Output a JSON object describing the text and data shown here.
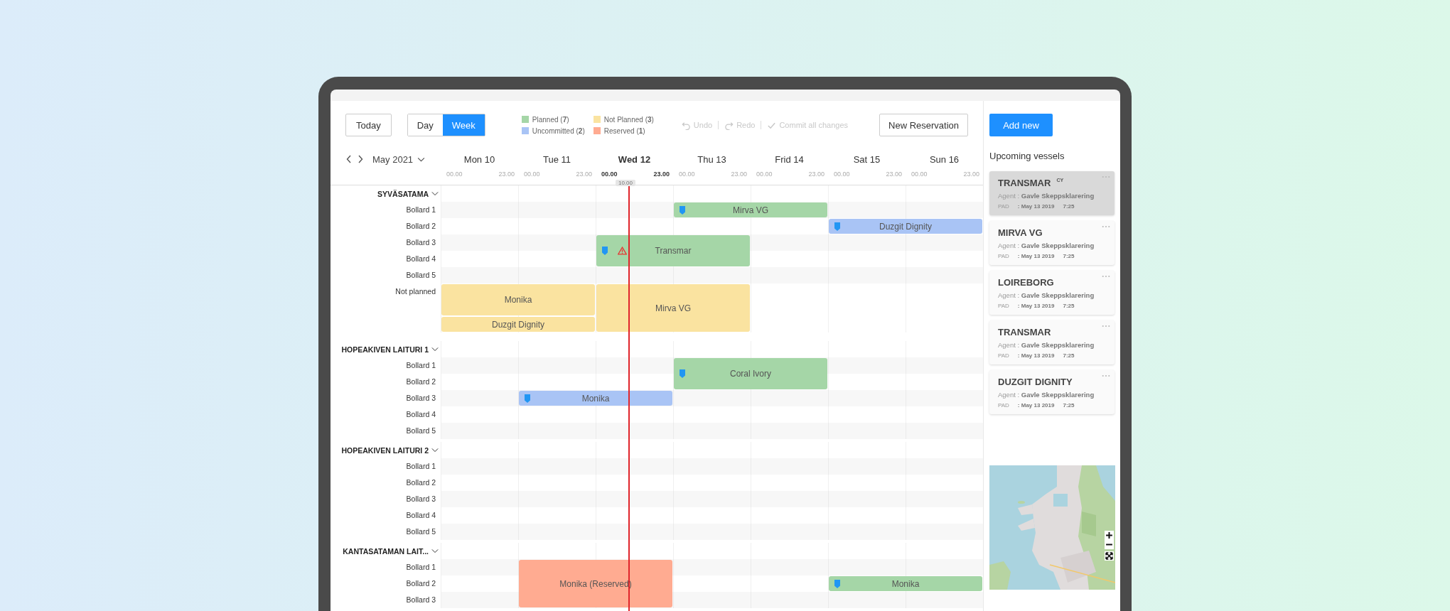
{
  "toolbar": {
    "today": "Today",
    "views": [
      {
        "label": "Day",
        "selected": false
      },
      {
        "label": "Week",
        "selected": true
      }
    ],
    "legend": [
      {
        "label": "Planned (**7**)",
        "color": "#a5d6a7"
      },
      {
        "label": "Not Planned (**3**)",
        "color": "#fae3a0"
      },
      {
        "label": "Uncommitted (**2**)",
        "color": "#a9c4f5"
      },
      {
        "label": "Reserved (**1**)",
        "color": "#ffab91"
      }
    ],
    "history": [
      {
        "kind": "undo",
        "label": "Undo",
        "disabled": true
      },
      {
        "kind": "redo",
        "label": "Redo",
        "disabled": true
      },
      {
        "kind": "commit",
        "label": "Commit all changes",
        "disabled": true
      }
    ],
    "new_reservation": "New Reservation"
  },
  "calendar": {
    "month": "May 2021",
    "now_marker": "10.00",
    "days": [
      {
        "label": "Mon 10",
        "start": "00.00",
        "end": "23.00",
        "selected": false
      },
      {
        "label": "Tue 11",
        "start": "00.00",
        "end": "23.00",
        "selected": false
      },
      {
        "label": "Wed 12",
        "start": "00.00",
        "end": "23.00",
        "selected": true
      },
      {
        "label": "Thu 13",
        "start": "00.00",
        "end": "23.00",
        "selected": false
      },
      {
        "label": "Frid 14",
        "start": "00.00",
        "end": "23.00",
        "selected": false
      },
      {
        "label": "Sat 15",
        "start": "00.00",
        "end": "23.00",
        "selected": false
      },
      {
        "label": "Sun 16",
        "start": "00.00",
        "end": "23.00",
        "selected": false
      }
    ],
    "groups": [
      {
        "name": "SYVÄSATAMA",
        "expanded": true,
        "lanes": [
          {
            "label": "Bollard 1",
            "kind": "bollard"
          },
          {
            "label": "Bollard 2",
            "kind": "bollard"
          },
          {
            "label": "Bollard 3",
            "kind": "bollard"
          },
          {
            "label": "Bollard 4",
            "kind": "bollard"
          },
          {
            "label": "Bollard 5",
            "kind": "bollard"
          },
          {
            "label": "Not planned",
            "kind": "unplanned"
          }
        ],
        "events": [
          {
            "label": "Mirva VG",
            "kind": "planned",
            "marker": true,
            "warning": false
          },
          {
            "label": "Duzgit Dignity",
            "kind": "uncommitted",
            "marker": true,
            "warning": false
          },
          {
            "label": "Transmar",
            "kind": "planned",
            "marker": true,
            "warning": true
          },
          {
            "label": "Monika",
            "kind": "not_planned",
            "marker": false,
            "warning": false
          },
          {
            "label": "Duzgit Dignity",
            "kind": "not_planned",
            "marker": false,
            "warning": false
          },
          {
            "label": "Mirva VG",
            "kind": "not_planned",
            "marker": false,
            "warning": false
          }
        ]
      },
      {
        "name": "HOPEAKIVEN LAITURI 1",
        "expanded": true,
        "lanes": [
          {
            "label": "Bollard 1",
            "kind": "bollard"
          },
          {
            "label": "Bollard 2",
            "kind": "bollard"
          },
          {
            "label": "Bollard 3",
            "kind": "bollard"
          },
          {
            "label": "Bollard 4",
            "kind": "bollard"
          },
          {
            "label": "Bollard 5",
            "kind": "bollard"
          }
        ],
        "events": [
          {
            "label": "Coral Ivory",
            "kind": "planned",
            "marker": true,
            "warning": false
          },
          {
            "label": "Monika",
            "kind": "uncommitted",
            "marker": true,
            "warning": false
          }
        ]
      },
      {
        "name": "HOPEAKIVEN LAITURI 2",
        "expanded": true,
        "lanes": [
          {
            "label": "Bollard 1",
            "kind": "bollard"
          },
          {
            "label": "Bollard 2",
            "kind": "bollard"
          },
          {
            "label": "Bollard 3",
            "kind": "bollard"
          },
          {
            "label": "Bollard 4",
            "kind": "bollard"
          },
          {
            "label": "Bollard 5",
            "kind": "bollard"
          }
        ]
      },
      {
        "name": "KANTASATAMAN LAIT...",
        "expanded": true,
        "lanes": [
          {
            "label": "Bollard 1",
            "kind": "bollard"
          },
          {
            "label": "Bollard 2",
            "kind": "bollard"
          },
          {
            "label": "Bollard 3",
            "kind": "bollard"
          }
        ],
        "events": [
          {
            "label": "Monika (Reserved)",
            "kind": "reserved",
            "marker": false,
            "warning": false
          },
          {
            "label": "Monika",
            "kind": "planned",
            "marker": true,
            "warning": false
          }
        ]
      }
    ]
  },
  "sidebar": {
    "add_new": "Add new",
    "title": "Upcoming vessels",
    "vessels": [
      {
        "name": "TRANSMAR",
        "flag": "CY",
        "agent": "Agent : **Gavle Skeppsklarering**",
        "pad": "PAD",
        "date": ": May 13 2019",
        "time": "7:25",
        "selected": true
      },
      {
        "name": "MIRVA VG",
        "agent": "Agent : **Gavle Skeppsklarering**",
        "pad": "PAD",
        "date": ": May 13 2019",
        "time": "7:25",
        "selected": false
      },
      {
        "name": "LOIREBORG",
        "agent": "Agent : **Gavle Skeppsklarering**",
        "pad": "PAD",
        "date": ": May 13 2019",
        "time": "7:25",
        "selected": false
      },
      {
        "name": "TRANSMAR",
        "agent": "Agent : **Gavle Skeppsklarering**",
        "pad": "PAD",
        "date": ": May 13 2019",
        "time": "7:25",
        "selected": false
      },
      {
        "name": "DUZGIT DIGNITY",
        "agent": "Agent : **Gavle Skeppsklarering**",
        "pad": "PAD",
        "date": ": May 13 2019",
        "time": "7:25",
        "selected": false
      }
    ]
  }
}
